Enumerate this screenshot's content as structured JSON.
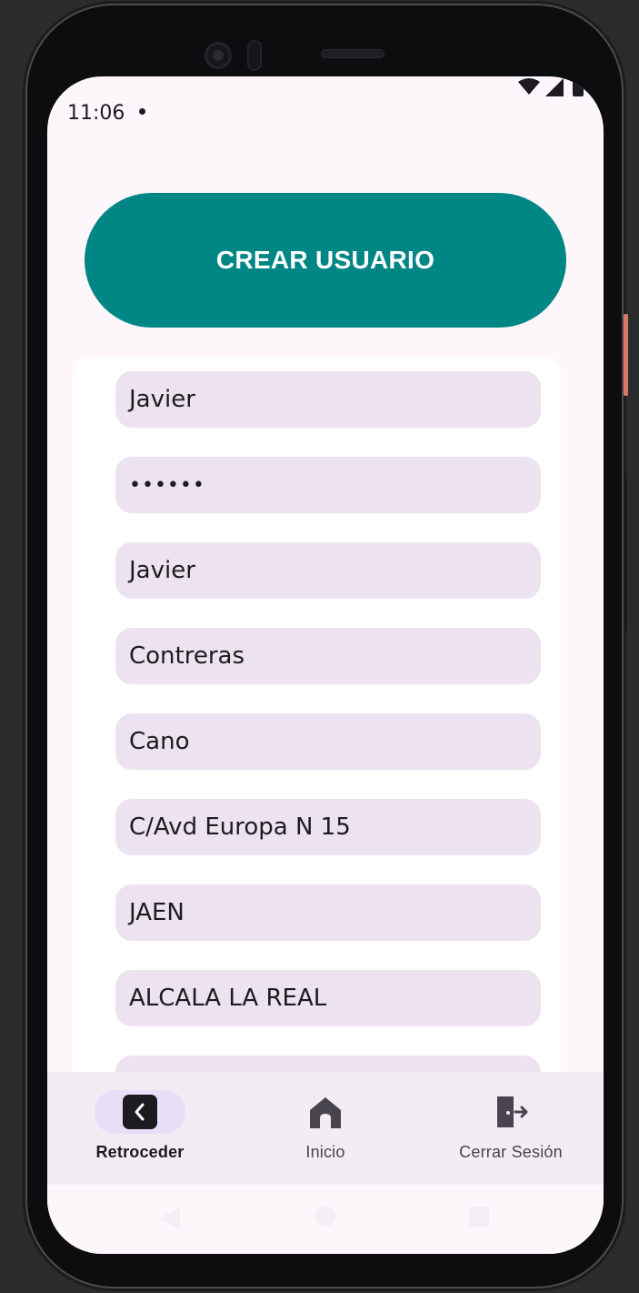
{
  "status_bar": {
    "time": "11:06"
  },
  "header": {
    "create_user_label": "CREAR USUARIO"
  },
  "form": {
    "fields": [
      "Javier",
      "••••••",
      "Javier",
      "Contreras",
      "Cano",
      "C/Avd Europa N 15",
      "JAEN",
      "ALCALA LA REAL"
    ]
  },
  "bottom_nav": {
    "items": [
      {
        "label": "Retroceder",
        "icon": "back-icon",
        "active": true
      },
      {
        "label": "Inicio",
        "icon": "home-icon",
        "active": false
      },
      {
        "label": "Cerrar Sesión",
        "icon": "logout-icon",
        "active": false
      }
    ]
  },
  "colors": {
    "accent": "#008684",
    "field_bg": "#ede2ef",
    "nav_active_pill": "#e8def8",
    "screen_bg": "#fdf7fc"
  }
}
